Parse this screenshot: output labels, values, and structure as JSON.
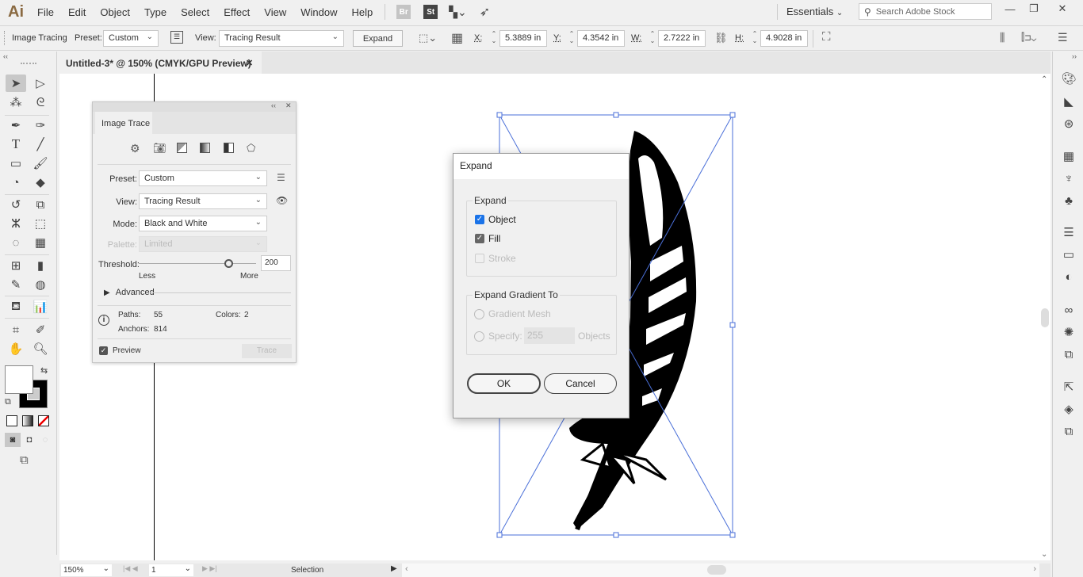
{
  "app": {
    "logo": "Ai",
    "menu": [
      "File",
      "Edit",
      "Object",
      "Type",
      "Select",
      "Effect",
      "View",
      "Window",
      "Help"
    ],
    "bridge_badge": "Br",
    "stock_badge": "St",
    "workspace": "Essentials",
    "search_placeholder": "Search Adobe Stock",
    "window_controls": {
      "minimize": "—",
      "restore": "❐",
      "close": "✕"
    }
  },
  "control_bar": {
    "context": "Image Tracing",
    "preset_label": "Preset:",
    "preset_value": "Custom",
    "view_label": "View:",
    "view_value": "Tracing Result",
    "expand_label": "Expand",
    "x_label": "X:",
    "x_value": "5.3889 in",
    "y_label": "Y:",
    "y_value": "4.3542 in",
    "w_label": "W:",
    "w_value": "2.7222 in",
    "h_label": "H:",
    "h_value": "4.9028 in"
  },
  "document": {
    "tab_title": "Untitled-3* @ 150% (CMYK/GPU Preview)",
    "tab_close": "✕"
  },
  "image_trace": {
    "tab": "Image Trace",
    "preset_label": "Preset:",
    "preset": "Custom",
    "view_label": "View:",
    "view": "Tracing Result",
    "mode_label": "Mode:",
    "mode": "Black and White",
    "palette_label": "Palette:",
    "palette": "Limited",
    "threshold_label": "Threshold:",
    "threshold_value": "200",
    "threshold_fraction": 0.78,
    "less_label": "Less",
    "more_label": "More",
    "advanced_label": "Advanced",
    "paths_label": "Paths:",
    "paths": "55",
    "colors_label": "Colors:",
    "colors": "2",
    "anchors_label": "Anchors:",
    "anchors": "814",
    "preview_label": "Preview",
    "preview_checked": true,
    "trace_label": "Trace"
  },
  "expand_dialog": {
    "title": "Expand",
    "expand_group": "Expand",
    "object_label": "Object",
    "object_checked": true,
    "fill_label": "Fill",
    "fill_checked": true,
    "stroke_label": "Stroke",
    "stroke_checked": false,
    "gradient_group": "Expand Gradient To",
    "gradient_mesh_label": "Gradient Mesh",
    "specify_label": "Specify:",
    "specify_value": "255",
    "objects_label": "Objects",
    "ok_label": "OK",
    "cancel_label": "Cancel"
  },
  "status_bar": {
    "zoom": "150%",
    "artboard": "1",
    "tool_status": "Selection"
  },
  "colors": {
    "selection_blue": "#4a6fd8",
    "checkbox_blue": "#1a73e8",
    "checkbox_gray": "#666666"
  }
}
